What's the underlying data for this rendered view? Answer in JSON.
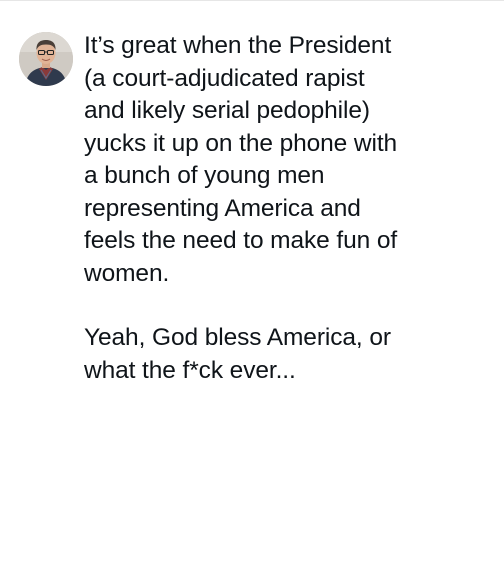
{
  "post": {
    "author_avatar": "avatar-photo",
    "paragraphs": [
      {
        "lines": [
          "It’s great when the President",
          "(a court-adjudicated rapist",
          "and likely serial pedophile)",
          "yucks it up on the phone with",
          "a bunch of young men",
          "representing America and",
          "feels the need to make fun of",
          "women."
        ]
      },
      {
        "lines": [
          "Yeah, God bless America, or",
          "what the f*ck ever..."
        ]
      }
    ]
  },
  "colors": {
    "text": "#0f1419",
    "background": "#ffffff",
    "divider": "#e6e6e6"
  }
}
